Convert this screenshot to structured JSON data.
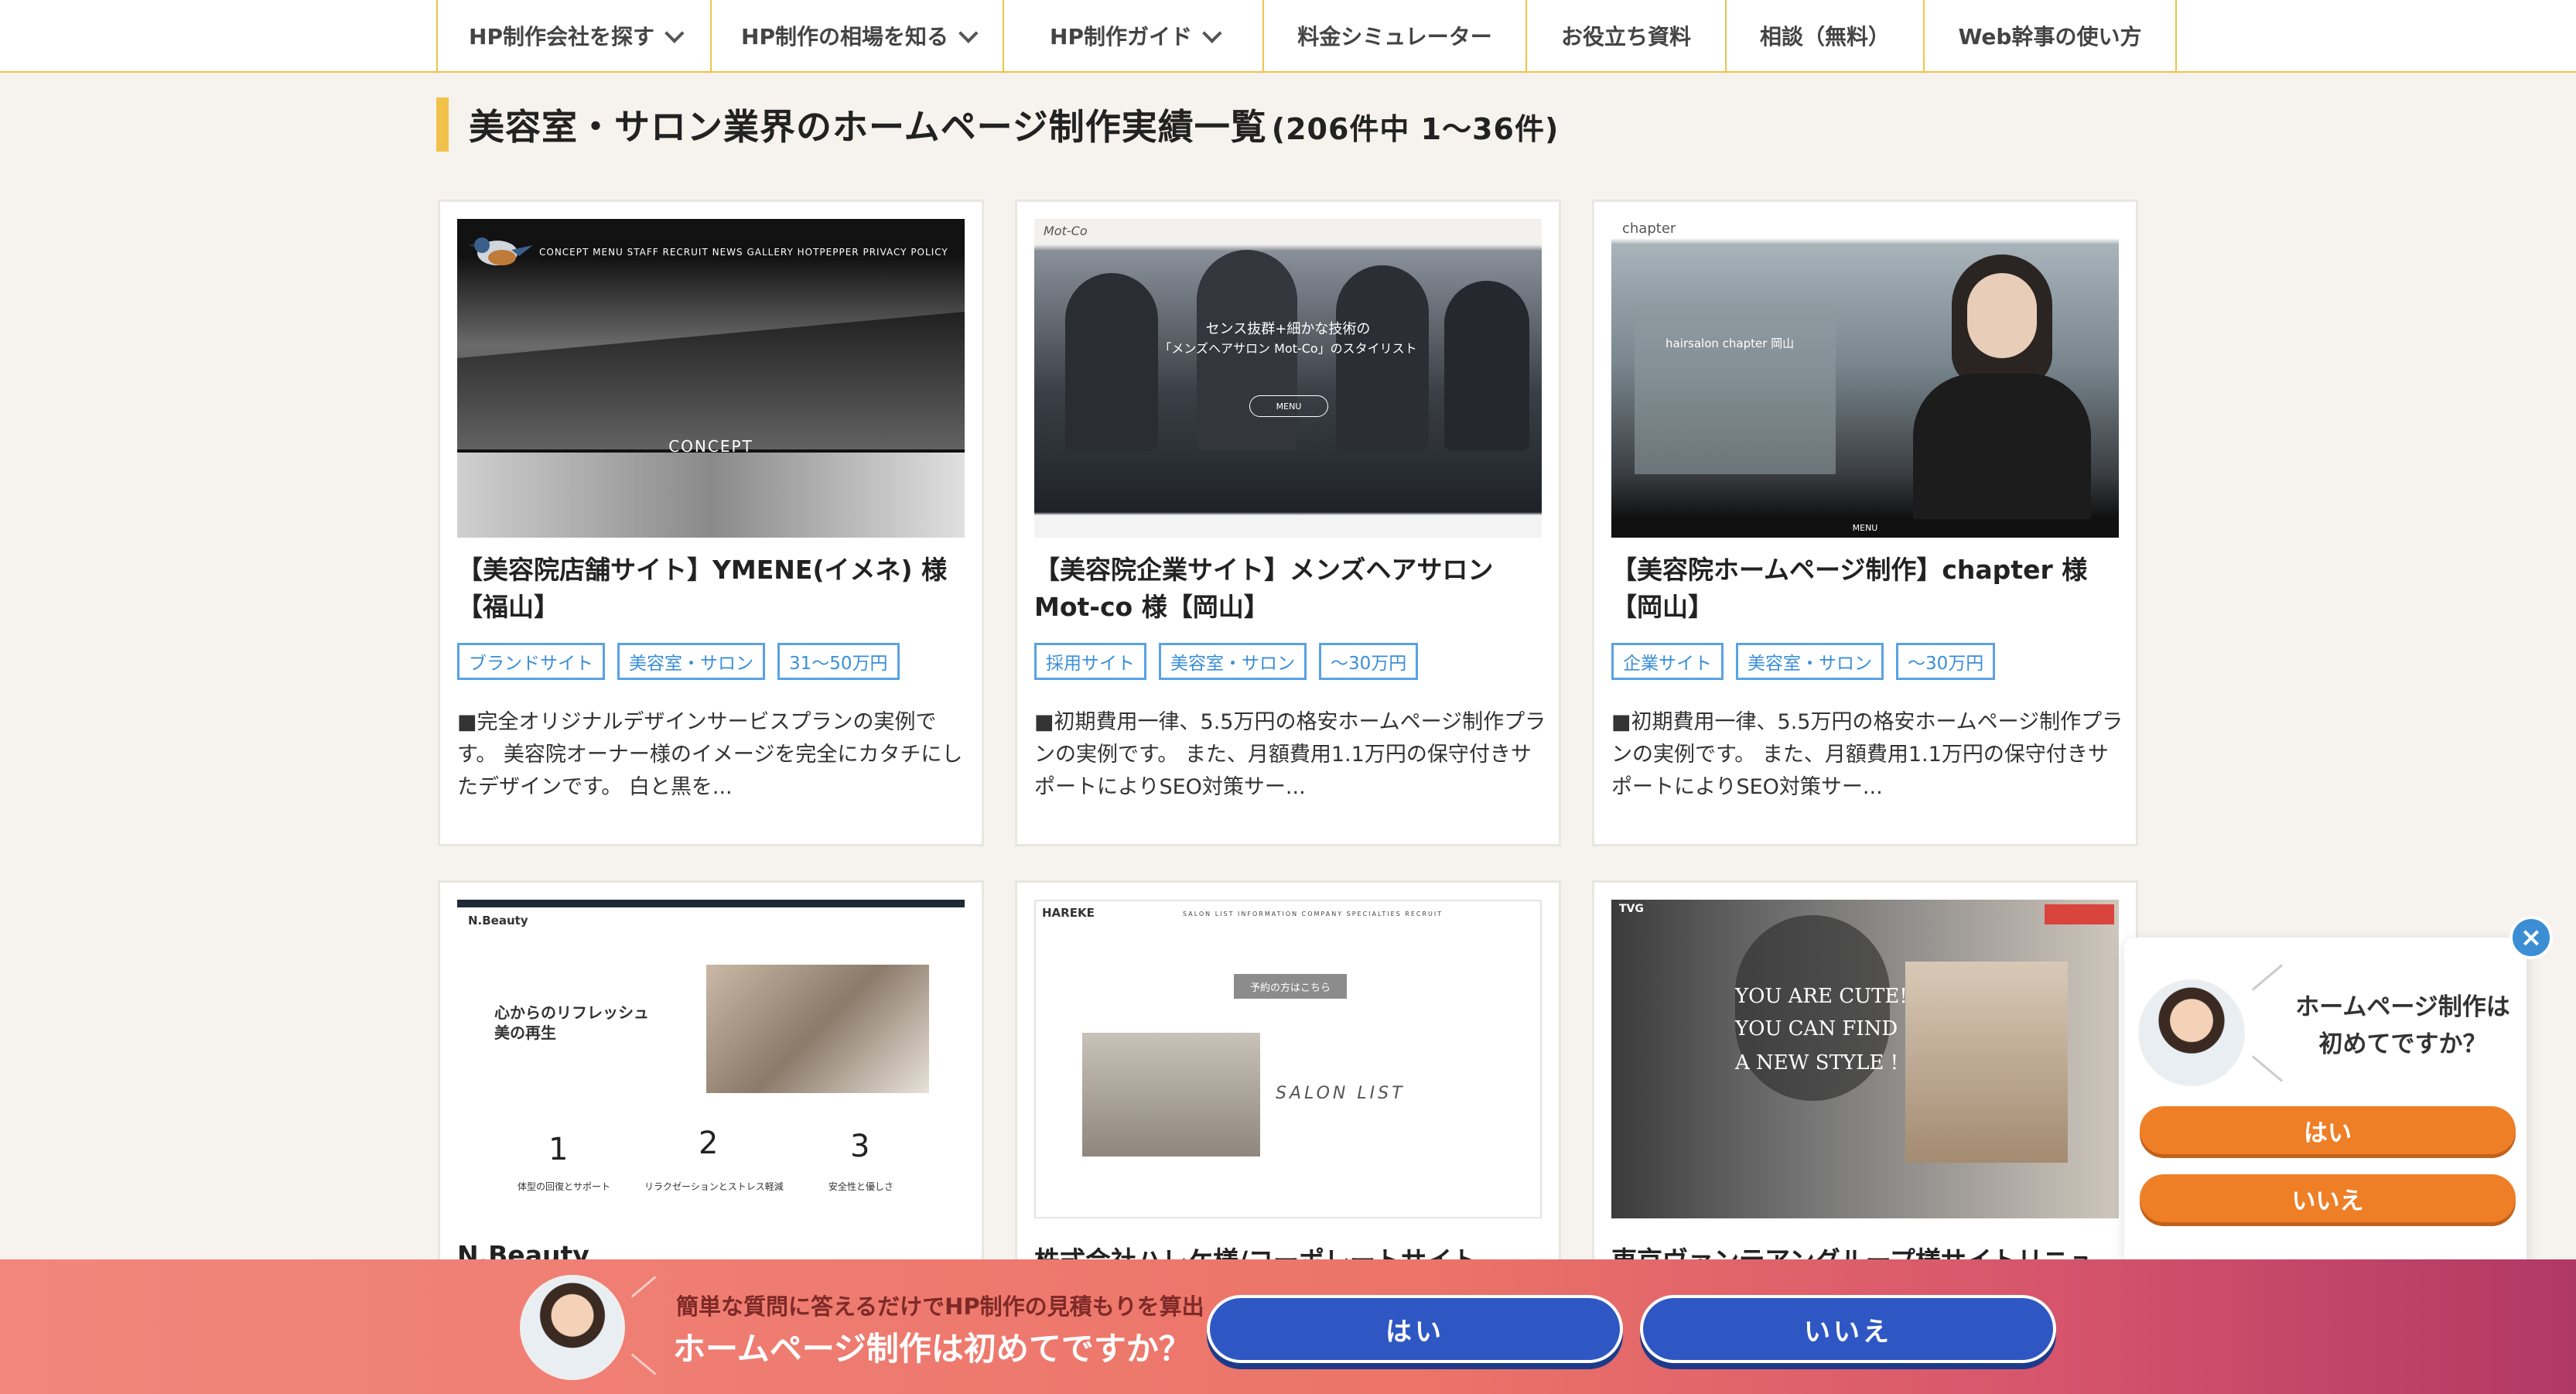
{
  "nav": {
    "items": [
      {
        "label": "HP制作会社を探す",
        "dropdown": true
      },
      {
        "label": "HP制作の相場を知る",
        "dropdown": true
      },
      {
        "label": "HP制作ガイド",
        "dropdown": true
      },
      {
        "label": "料金シミュレーター",
        "dropdown": false
      },
      {
        "label": "お役立ち資料",
        "dropdown": false
      },
      {
        "label": "相談（無料）",
        "dropdown": false
      },
      {
        "label": "Web幹事の使い方",
        "dropdown": false
      }
    ]
  },
  "heading": {
    "title": "美容室・サロン業界のホームページ制作実績一覧",
    "count": "(206件中 1〜36件)"
  },
  "cards": [
    {
      "title": "【美容院店舗サイト】YMENE(イメネ) 様【福山】",
      "tags": [
        "ブランドサイト",
        "美容室・サロン",
        "31〜50万円"
      ],
      "desc": "■完全オリジナルデザインサービスプランの実例です。 美容院オーナー様のイメージを完全にカタチにしたデザインです。 白と黒を...",
      "thumb": {
        "nav": "CONCEPT  MENU  STAFF  RECRUIT  NEWS  GALLERY  HOTPEPPER  PRIVACY POLICY",
        "caption": "CONCEPT"
      }
    },
    {
      "title": "【美容院企業サイト】メンズヘアサロンMot-co 様【岡山】",
      "tags": [
        "採用サイト",
        "美容室・サロン",
        "〜30万円"
      ],
      "desc": "■初期費用一律、5.5万円の格安ホームページ制作プランの実例です。 また、月額費用1.1万円の保守付きサポートによりSEO対策サー...",
      "thumb": {
        "logo": "Mot-Co",
        "line1": "センス抜群+細かな技術の",
        "line2": "「メンズヘアサロン Mot-Co」のスタイリスト",
        "button": "MENU"
      }
    },
    {
      "title": "【美容院ホームページ制作】chapter 様【岡山】",
      "tags": [
        "企業サイト",
        "美容室・サロン",
        "〜30万円"
      ],
      "desc": "■初期費用一律、5.5万円の格安ホームページ制作プランの実例です。 また、月額費用1.1万円の保守付きサポートによりSEO対策サー...",
      "thumb": {
        "logo": "chapter",
        "caption": "hairsalon chapter 岡山",
        "footer": "MENU"
      }
    },
    {
      "title": "N.Beauty",
      "thumb": {
        "logo": "N.Beauty",
        "heading1": "心からのリフレッシュ",
        "heading2": "美の再生",
        "steps": [
          {
            "num": "1",
            "label": "体型の回復とサポート"
          },
          {
            "num": "2",
            "label": "リラクゼーションとストレス軽減"
          },
          {
            "num": "3",
            "label": "安全性と優しさ"
          }
        ]
      }
    },
    {
      "title": "株式会社ハレケ様/コーポレートサイト",
      "thumb": {
        "logo": "HAREKE",
        "menu": "SALON LIST   INFORMATION   COMPANY   SPECIALTIES   RECRUIT",
        "pill": "予約の方はこちら",
        "caption": "SALON LIST"
      }
    },
    {
      "title": "東京ヴァンテアングループ様サイトリニュ",
      "thumb": {
        "logo": "TVG",
        "line1": "YOU ARE CUTE!",
        "line2": "YOU CAN FIND",
        "line3": "A NEW STYLE !"
      }
    }
  ],
  "popup": {
    "question_line1": "ホームページ制作は",
    "question_line2": "初めてですか？",
    "yes": "はい",
    "no": "いいえ",
    "close": "×"
  },
  "banner": {
    "sub": "簡単な質問に答えるだけでHP制作の見積もりを算出",
    "main": "ホームページ制作は初めてですか？",
    "yes": "はい",
    "no": "いいえ"
  },
  "colors": {
    "accent": "#f1c24a",
    "tag": "#3a8ed8",
    "popup_button": "#ee7f27",
    "banner_button": "#2f57c4",
    "banner_bg": "#ec7468"
  }
}
